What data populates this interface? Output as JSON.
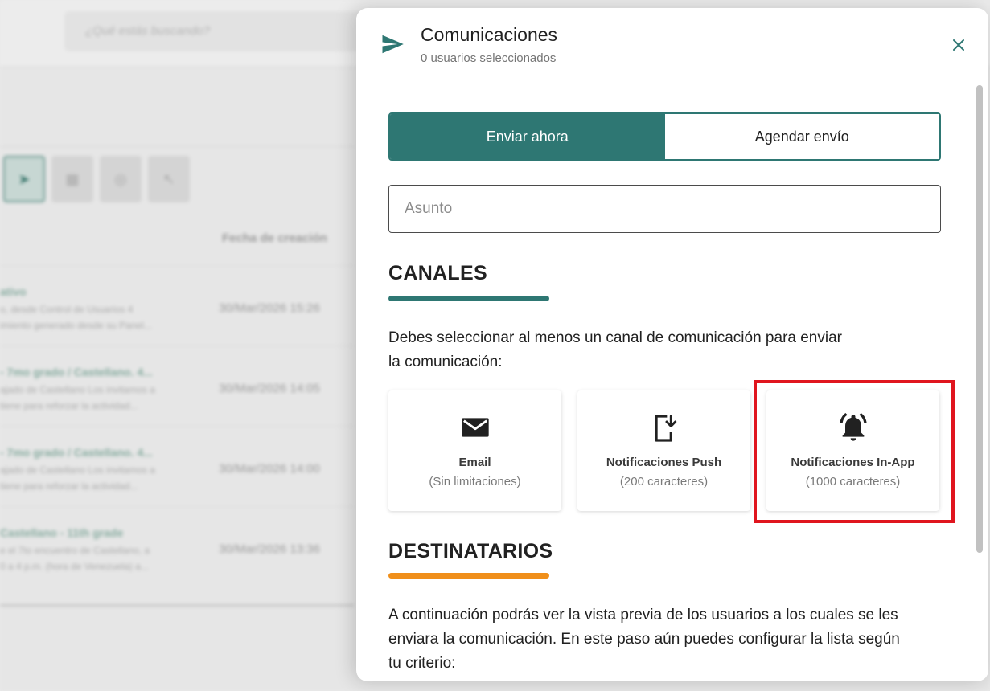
{
  "background": {
    "search_placeholder": "¿Qué estás buscando?",
    "column_header": "Fecha de creación",
    "rows": [
      {
        "title": "ativo",
        "desc1": "o, desde Control de Usuarios 4",
        "desc2": "imiento generado desde su Panel...",
        "date": "30/Mar/2026 15:26"
      },
      {
        "title": "- 7mo grado / Castellano. 4...",
        "desc1": "ajado de Castellano Los invitamos a",
        "desc2": "tiene para reforzar la actividad...",
        "date": "30/Mar/2026 14:05"
      },
      {
        "title": "- 7mo grado / Castellano. 4...",
        "desc1": "ajado de Castellano Los invitamos a",
        "desc2": "tiene para reforzar la actividad...",
        "date": "30/Mar/2026 14:00"
      },
      {
        "title": "Castellano - 11th grade",
        "desc1": "e el 7to encuentro de Castellano, a",
        "desc2": "0 a 4 p.m. (hora de Venezuela) a...",
        "date": "30/Mar/2026 13:36"
      }
    ]
  },
  "modal": {
    "title": "Comunicaciones",
    "subtitle": "0 usuarios seleccionados",
    "tabs": {
      "send_now": "Enviar ahora",
      "schedule": "Agendar envío"
    },
    "subject_placeholder": "Asunto",
    "channels_section": {
      "heading": "CANALES",
      "underline_color": "#2e7773",
      "description_line1": "Debes seleccionar al menos un canal de comunicación para enviar",
      "description_line2": "la comunicación:",
      "items": [
        {
          "name": "Email",
          "limit": "(Sin limitaciones)",
          "icon": "email-icon"
        },
        {
          "name": "Notificaciones Push",
          "limit": "(200 caracteres)",
          "icon": "phone-download-icon"
        },
        {
          "name": "Notificaciones In-App",
          "limit": "(1000 caracteres)",
          "icon": "bell-ring-icon"
        }
      ]
    },
    "recipients_section": {
      "heading": "DESTINATARIOS",
      "underline_color": "#f08f1a",
      "description_line1": "A continuación podrás ver la vista previa de los usuarios a los cuales se les",
      "description_line2": "enviara la comunicación. En este paso aún puedes configurar la lista según",
      "description_line3": "tu criterio:"
    }
  },
  "colors": {
    "accent": "#2e7773",
    "secondary_accent": "#f08f1a",
    "highlight": "#e0151e"
  }
}
